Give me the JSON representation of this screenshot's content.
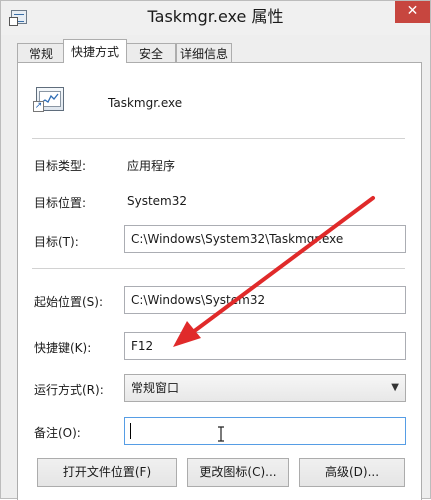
{
  "window": {
    "title": "Taskmgr.exe 属性",
    "close_glyph": "✕"
  },
  "tabs": [
    {
      "label": "常规",
      "active": false
    },
    {
      "label": "快捷方式",
      "active": true
    },
    {
      "label": "安全",
      "active": false
    },
    {
      "label": "详细信息",
      "active": false
    }
  ],
  "shortcut": {
    "name": "Taskmgr.exe",
    "target_type_label": "目标类型:",
    "target_type_value": "应用程序",
    "target_location_label": "目标位置:",
    "target_location_value": "System32",
    "target_label": "目标(T):",
    "target_value": "C:\\Windows\\System32\\Taskmgr.exe",
    "start_in_label": "起始位置(S):",
    "start_in_value": "C:\\Windows\\System32",
    "hotkey_label": "快捷键(K):",
    "hotkey_value": "F12",
    "run_label": "运行方式(R):",
    "run_value": "常规窗口",
    "comment_label": "备注(O):",
    "comment_value": ""
  },
  "buttons": {
    "open_location": "打开文件位置(F)",
    "change_icon": "更改图标(C)...",
    "advanced": "高级(D)..."
  },
  "icons": {
    "app": "task-manager-icon",
    "dropdown": "chevron-down-icon"
  },
  "colors": {
    "close_button": "#c7463f",
    "annotation_arrow": "#e02a2a",
    "focus_border": "#569de5"
  }
}
